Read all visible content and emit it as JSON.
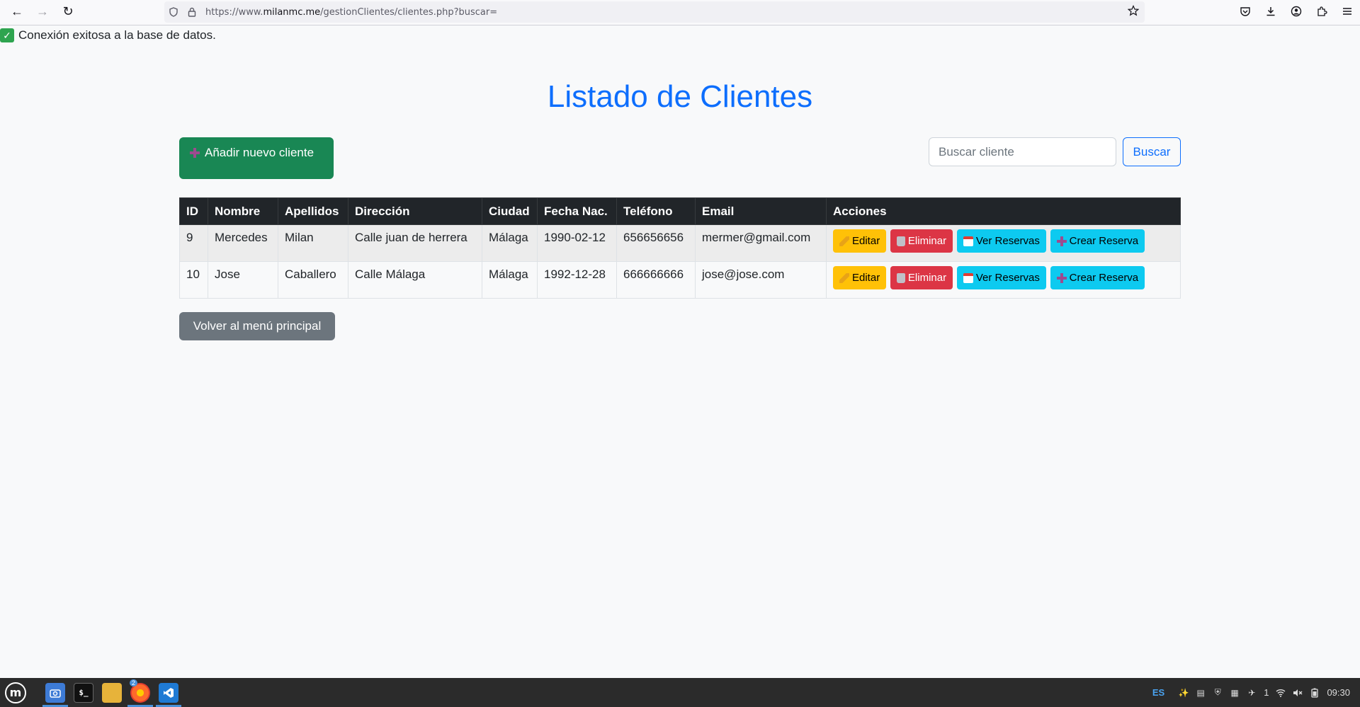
{
  "browser": {
    "url_prefix": "https://www.",
    "url_domain": "milanmc.me",
    "url_path": "/gestionClientes/clientes.php?buscar="
  },
  "page": {
    "db_status": "Conexión exitosa a la base de datos.",
    "title": "Listado de Clientes",
    "add_button": "Añadir nuevo cliente",
    "search_placeholder": "Buscar cliente",
    "search_button": "Buscar",
    "back_button": "Volver al menú principal"
  },
  "table": {
    "headers": [
      "ID",
      "Nombre",
      "Apellidos",
      "Dirección",
      "Ciudad",
      "Fecha Nac.",
      "Teléfono",
      "Email",
      "Acciones"
    ],
    "rows": [
      {
        "id": "9",
        "nombre": "Mercedes",
        "apellidos": "Milan",
        "direccion": "Calle juan de herrera",
        "ciudad": "Málaga",
        "fecha": "1990-02-12",
        "telefono": "656656656",
        "email": "mermer@gmail.com"
      },
      {
        "id": "10",
        "nombre": "Jose",
        "apellidos": "Caballero",
        "direccion": "Calle Málaga",
        "ciudad": "Málaga",
        "fecha": "1992-12-28",
        "telefono": "666666666",
        "email": "jose@jose.com"
      }
    ],
    "actions": {
      "edit": "Editar",
      "delete": "Eliminar",
      "view_reservations": "Ver Reservas",
      "create_reservation": "Crear Reserva"
    }
  },
  "taskbar": {
    "firefox_badge": "2",
    "keyboard_layout": "ES",
    "notifications": "1",
    "clock": "09:30"
  },
  "colors": {
    "primary": "#0d6efd",
    "success": "#198754",
    "warning": "#ffc107",
    "danger": "#dc3545",
    "info": "#0dcaf0",
    "secondary": "#6c757d",
    "dark": "#212529"
  }
}
